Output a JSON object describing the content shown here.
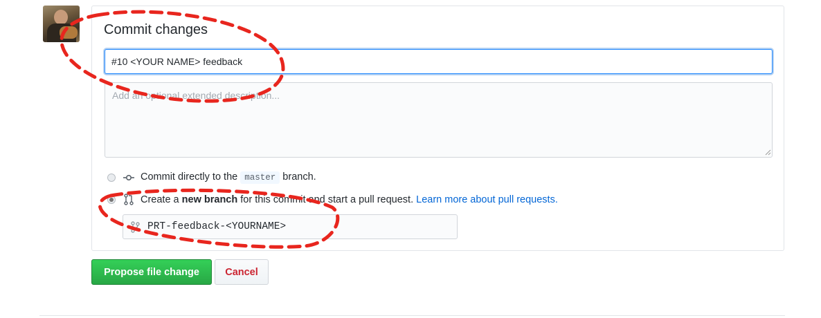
{
  "commit_form": {
    "title": "Commit changes",
    "summary_value": "#10 <YOUR NAME> feedback",
    "description_placeholder": "Add an optional extended description...",
    "option_direct": {
      "prefix": "Commit directly to the",
      "branch_name": "master",
      "suffix": "branch."
    },
    "option_new_branch": {
      "prefix": "Create a",
      "bold_text": "new branch",
      "suffix": "for this commit and start a pull request.",
      "link_text": "Learn more about pull requests.",
      "selected": true
    },
    "new_branch_name": "PRT-feedback-<YOURNAME>"
  },
  "buttons": {
    "propose_label": "Propose file change",
    "cancel_label": "Cancel"
  },
  "colors": {
    "accent_blue": "#0366d6",
    "propose_green": "#28a745",
    "cancel_red": "#cb2431",
    "annotation_red": "#e8261e"
  },
  "icons": {
    "avatar": "user-avatar",
    "commit_option": "git-commit-icon",
    "branch_option": "git-pull-request-icon",
    "branch_input": "git-branch-icon"
  }
}
